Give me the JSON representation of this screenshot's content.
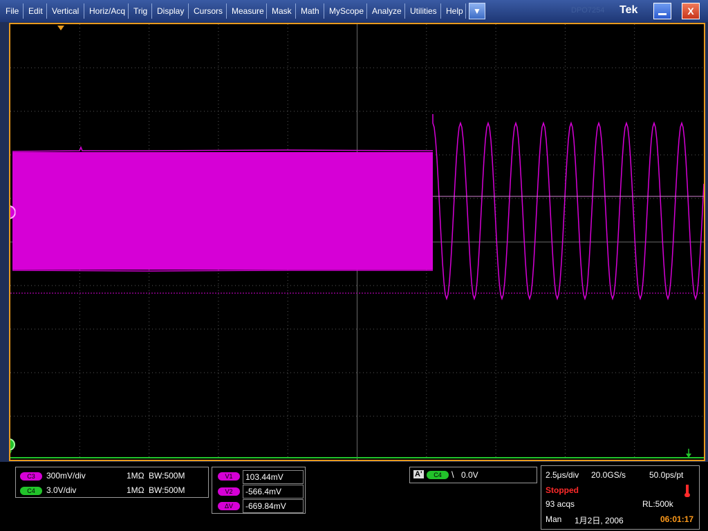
{
  "menu": {
    "items": [
      "File",
      "Edit",
      "Vertical",
      "Horiz/Acq",
      "Trig",
      "Display",
      "Cursors",
      "Measure",
      "Mask",
      "Math",
      "MyScope",
      "Analyze",
      "Utilities",
      "Help"
    ],
    "dropdown_glyph": "▼"
  },
  "titlebar": {
    "model": "DPO7254",
    "brand": "Tek",
    "close_glyph": "X"
  },
  "screen": {
    "ch3_marker": "3",
    "ch4_marker": "4",
    "colors": {
      "ch3": "#d600d6",
      "ch4": "#22c32a",
      "frame": "#e89a1e",
      "grid": "#5a5a5a"
    }
  },
  "channels": [
    {
      "badge": "C3",
      "scale": "300mV/div",
      "coupling": "1MΩ",
      "bw": "BW:500M",
      "color": "#d600d6"
    },
    {
      "badge": "C4",
      "scale": "3.0V/div",
      "coupling": "1MΩ",
      "bw": "BW:500M",
      "color": "#22c32a"
    }
  ],
  "cursors": [
    {
      "label": "V1",
      "value": "103.44mV"
    },
    {
      "label": "V2",
      "value": "-566.4mV"
    },
    {
      "label": "ΔV",
      "value": "-669.84mV"
    }
  ],
  "trigger": {
    "mode": "A'",
    "source": "C4",
    "slope": "\\",
    "level": "0.0V"
  },
  "acq": {
    "timebase": "2.5μs/div",
    "samplerate": "20.0GS/s",
    "resolution": "50.0ps/pt",
    "status": "Stopped",
    "acqs": "93 acqs",
    "record": "RL:500k",
    "mode": "Man",
    "date": "1月2日, 2006",
    "time": "06:01:17"
  }
}
